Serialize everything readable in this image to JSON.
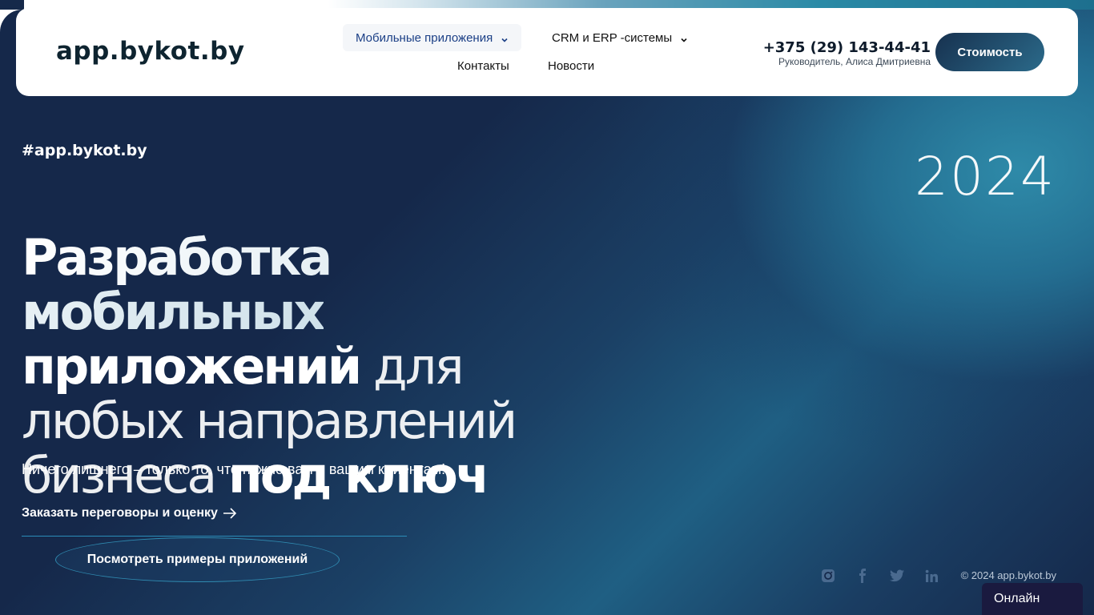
{
  "header": {
    "logo": "app.bykot.by",
    "nav": [
      {
        "label": "Мобильные приложения",
        "has_dropdown": true,
        "active": true
      },
      {
        "label": "CRM и ERP -системы",
        "has_dropdown": true,
        "active": false
      },
      {
        "label": "Контакты",
        "has_dropdown": false,
        "active": false
      },
      {
        "label": "Новости",
        "has_dropdown": false,
        "active": false
      }
    ],
    "phone": "+375 (29) 143-44-41",
    "phone_caption": "Руководитель, Алиса Дмитриевна",
    "price_button": "Стоимость"
  },
  "hero": {
    "hashtag": "#app.bykot.by",
    "year": "2024",
    "headline": {
      "part1_bold": "Разработка мобильных",
      "part2_bold": "приложений",
      "part3_light": "для любых направлений бизнеса",
      "part4_bold": "под ключ"
    },
    "subtitle": "Ничего лишнего – только то, что нужно вам и вашим клиентам!",
    "cta_link": "Заказать переговоры и оценку",
    "examples_button": "Посмотреть примеры приложений"
  },
  "footer": {
    "social_icons": [
      "instagram-icon",
      "facebook-icon",
      "twitter-icon",
      "linkedin-icon"
    ],
    "copyright": "© 2024 app.bykot.by"
  },
  "widget": {
    "online_label": "Онлайн"
  },
  "colors": {
    "hero_bg": "#15284a",
    "accent_teal": "#2a8aa6",
    "nav_active_text": "#1b3f86",
    "price_button_bg": "#17314f",
    "online_widget_bg": "#1a1a3f"
  }
}
